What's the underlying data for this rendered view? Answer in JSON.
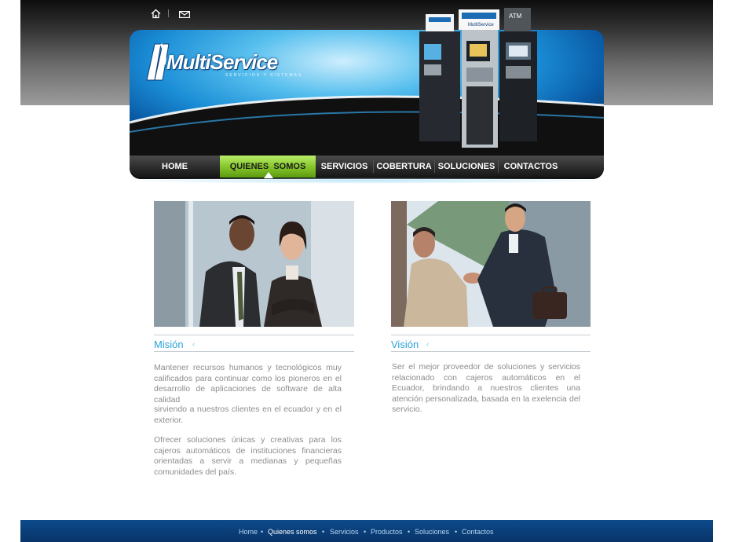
{
  "brand": {
    "name": "MultiService",
    "tagline": "SERVICIOS Y SISTEMAS"
  },
  "utility": {
    "icons": [
      "home-icon",
      "mail-icon"
    ]
  },
  "nav": {
    "items": [
      {
        "label": "HOME"
      },
      {
        "label": "QUIENES  SOMOS",
        "active": true
      },
      {
        "label": "SERVICIOS"
      },
      {
        "label": "COBERTURA"
      },
      {
        "label": "SOLUCIONES"
      },
      {
        "label": "CONTACTOS"
      }
    ]
  },
  "atm_signs": [
    "MultiService",
    "ATM"
  ],
  "sections": {
    "mision": {
      "title": "Misión",
      "paragraphs": [
        "Mantener recursos humanos y tecnológicos muy calificados para continuar como los pioneros en el desarrollo de aplicaciones de software de alta calidad",
        "sirviendo a nuestros clientes en el ecuador y en el exterior.",
        "Ofrecer soluciones únicas y creativas para los cajeros automáticos de instituciones financieras orientadas a servir a medianas y pequeñas comunidades del país."
      ]
    },
    "vision": {
      "title": "Visión",
      "paragraphs": [
        "Ser el mejor proveedor de soluciones y servicios relacionado con cajeros automáticos en el Ecuador, brindando a nuestros clientes una atención personalizada, basada en la exelencia del servicio."
      ]
    }
  },
  "footer": {
    "links": [
      {
        "label": "Home"
      },
      {
        "label": "Quienes somos",
        "current": true
      },
      {
        "label": "Servicios"
      },
      {
        "label": "Productos"
      },
      {
        "label": "Soluciones"
      },
      {
        "label": "Contactos"
      }
    ],
    "separator": "•"
  },
  "colors": {
    "accent": "#2aa2d8",
    "nav_active": "#86c72c",
    "footer_bg": "#0b3f7a",
    "body_text": "#8d8d8d"
  }
}
